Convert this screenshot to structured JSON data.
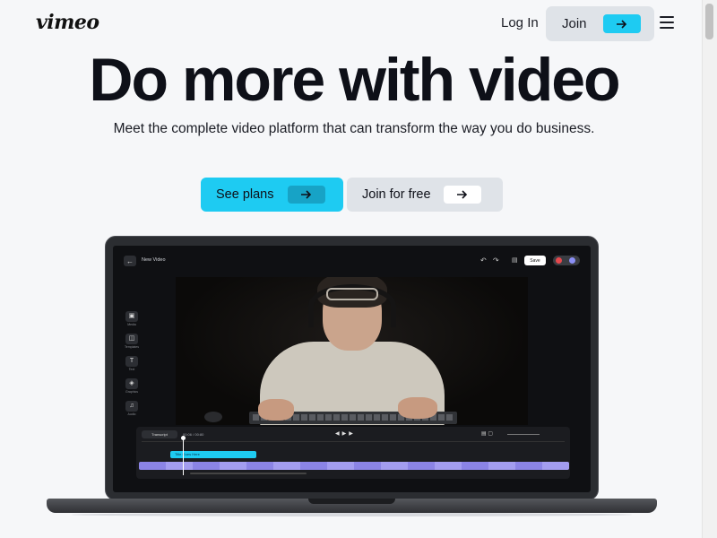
{
  "header": {
    "logo": "vimeo",
    "login_label": "Log In",
    "join_label": "Join"
  },
  "hero": {
    "title": "Do more with video",
    "subtitle": "Meet the complete video platform that can transform the way you do business.",
    "primary_button": "See plans",
    "secondary_button": "Join for free"
  },
  "editor": {
    "project_title": "New Video",
    "save_label": "Save",
    "sidebar": [
      {
        "label": "Media",
        "icon": "image-icon"
      },
      {
        "label": "Templates",
        "icon": "layout-icon"
      },
      {
        "label": "Text",
        "icon": "text-icon"
      },
      {
        "label": "Graphics",
        "icon": "shapes-icon"
      },
      {
        "label": "Audio",
        "icon": "music-icon"
      }
    ],
    "timeline": {
      "transcript_label": "Transcript",
      "time": "00:06 / 00:80",
      "title_clip": "Title Goes Here"
    }
  },
  "colors": {
    "accent": "#1ecbf2",
    "accent_dark": "#17a3c6",
    "background": "#f6f7f9",
    "secondary_button": "#dfe3e8",
    "text": "#0e1018"
  }
}
